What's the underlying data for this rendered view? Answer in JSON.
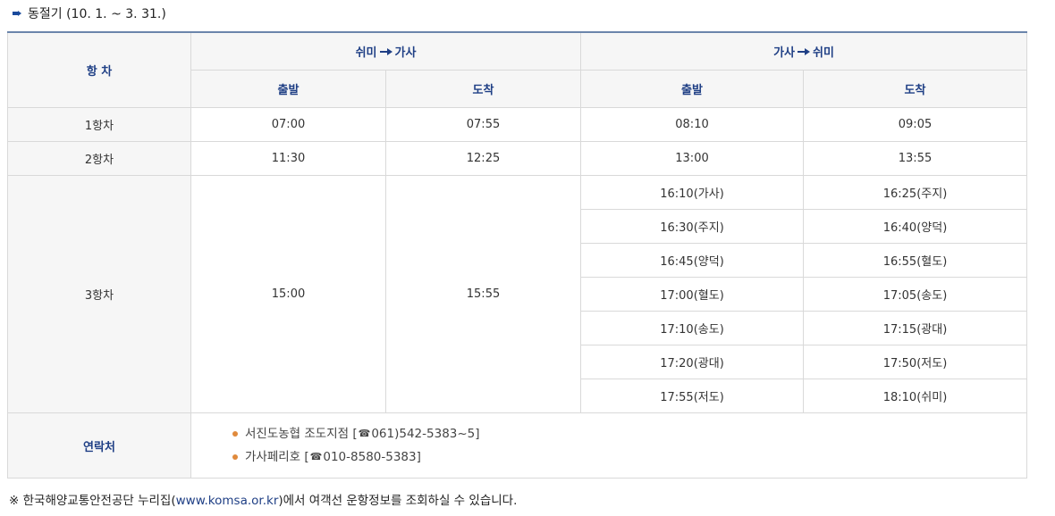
{
  "season_title": "동절기 (10. 1. ~ 3. 31.)",
  "table": {
    "voyage_header": "항 차",
    "route1": {
      "from": "쉬미",
      "to": "가사"
    },
    "route2": {
      "from": "가사",
      "to": "쉬미"
    },
    "depart_label": "출발",
    "arrive_label": "도착",
    "rows": {
      "r1": {
        "name": "1항차",
        "dep1": "07:00",
        "arr1": "07:55",
        "dep2": "08:10",
        "arr2": "09:05"
      },
      "r2": {
        "name": "2항차",
        "dep1": "11:30",
        "arr1": "12:25",
        "dep2": "13:00",
        "arr2": "13:55"
      },
      "r3": {
        "name": "3항차",
        "dep1": "15:00",
        "arr1": "15:55",
        "stops": [
          {
            "dep": "16:10(가사)",
            "arr": "16:25(주지)"
          },
          {
            "dep": "16:30(주지)",
            "arr": "16:40(양덕)"
          },
          {
            "dep": "16:45(양덕)",
            "arr": "16:55(혈도)"
          },
          {
            "dep": "17:00(혈도)",
            "arr": "17:05(송도)"
          },
          {
            "dep": "17:10(송도)",
            "arr": "17:15(광대)"
          },
          {
            "dep": "17:20(광대)",
            "arr": "17:50(저도)"
          },
          {
            "dep": "17:55(저도)",
            "arr": "18:10(쉬미)"
          }
        ]
      }
    },
    "contact_header": "연락처",
    "contacts": [
      {
        "prefix": "서진도농협 조도지점 [",
        "phone": "061)542-5383~5]"
      },
      {
        "prefix": "가사페리호 [",
        "phone": "010-8580-5383]"
      }
    ],
    "phone_icon": "telephone-icon"
  },
  "note": {
    "prefix": "※ 한국해양교통안전공단 누리집(",
    "link": "www.komsa.or.kr",
    "suffix": ")에서 여객선 운항정보를 조회하실 수 있습니다."
  },
  "colors": {
    "header_text": "#1f3f85",
    "bullet": "#e08a3c",
    "top_border": "#6b85ab"
  }
}
